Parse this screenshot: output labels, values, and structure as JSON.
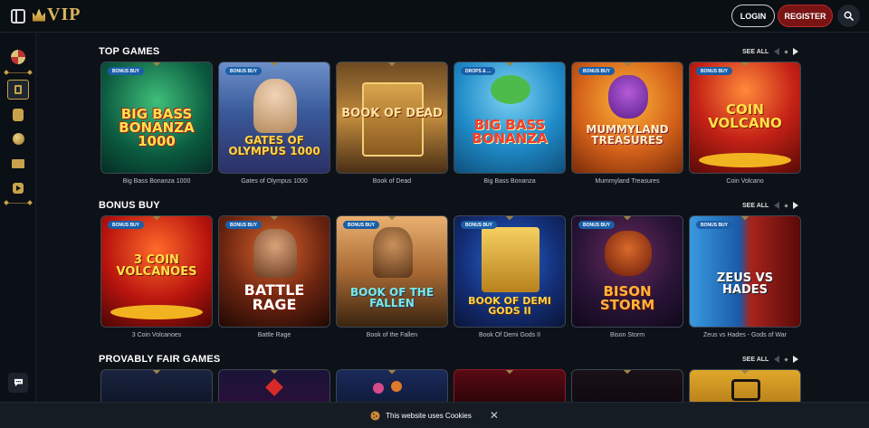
{
  "header": {
    "logo_text": "VIP",
    "login_label": "LOGIN",
    "register_label": "REGISTER",
    "icons": [
      "sidebar-toggle-icon",
      "search-icon"
    ]
  },
  "sidebar": {
    "icons": [
      "wheel-icon",
      "slot-icon",
      "cards-icon",
      "ball-icon",
      "live-icon",
      "video-icon",
      "chat-icon"
    ]
  },
  "sections": [
    {
      "title": "TOP GAMES",
      "see_all": "SEE ALL",
      "games": [
        {
          "name": "Big Bass Bonanza 1000",
          "badge": "BONUS BUY",
          "art": "BIG BASS BONANZA 1000"
        },
        {
          "name": "Gates of Olympus 1000",
          "badge": "BONUS BUY",
          "art": "GATES OF OLYMPUS 1000"
        },
        {
          "name": "Book of Dead",
          "badge": "",
          "art": "BOOK OF DEAD"
        },
        {
          "name": "Big Bass Bonanza",
          "badge": "DROPS & ...",
          "art": "BIG BASS BONANZA"
        },
        {
          "name": "Mummyland Treasures",
          "badge": "BONUS BUY",
          "art": "MUMMYLAND TREASURES"
        },
        {
          "name": "Coin Volcano",
          "badge": "BONUS BUY",
          "art": "COIN VOLCANO"
        }
      ]
    },
    {
      "title": "BONUS BUY",
      "see_all": "SEE ALL",
      "games": [
        {
          "name": "3 Coin Volcanoes",
          "badge": "BONUS BUY",
          "art": "3 COIN VOLCANOES"
        },
        {
          "name": "Battle Rage",
          "badge": "BONUS BUY",
          "art": "BATTLE RAGE"
        },
        {
          "name": "Book of the Fallen",
          "badge": "BONUS BUY",
          "art": "BOOK OF THE FALLEN"
        },
        {
          "name": "Book Of Demi Gods II",
          "badge": "BONUS BUY",
          "art": "BOOK OF DEMI GODS II"
        },
        {
          "name": "Bison Storm",
          "badge": "BONUS BUY",
          "art": "BISON STORM"
        },
        {
          "name": "Zeus vs Hades - Gods of War",
          "badge": "BONUS BUY",
          "art": "ZEUS VS HADES"
        }
      ]
    },
    {
      "title": "PROVABLY FAIR GAMES",
      "see_all": "SEE ALL",
      "games": [
        {
          "name": "",
          "badge": "",
          "art": ""
        },
        {
          "name": "",
          "badge": "",
          "art": ""
        },
        {
          "name": "",
          "badge": "",
          "art": ""
        },
        {
          "name": "",
          "badge": "",
          "art": ""
        },
        {
          "name": "",
          "badge": "",
          "art": ""
        },
        {
          "name": "",
          "badge": "",
          "art": ""
        }
      ]
    }
  ],
  "cookie_banner": {
    "text": "This website uses Cookies"
  },
  "colors": {
    "background": "#0d1218",
    "gold_accent": "#c9a24b",
    "register_red": "#7a1414",
    "badge_blue": "#1a5fa8"
  }
}
